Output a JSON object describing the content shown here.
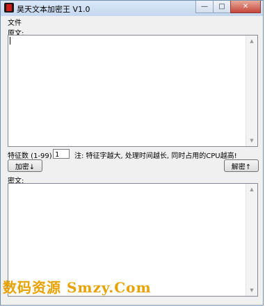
{
  "window": {
    "title": "昊天文本加密王 V1.0",
    "controls": {
      "minimize": "—",
      "maximize": "□",
      "close": "✕"
    }
  },
  "menu": {
    "file": "文件"
  },
  "plaintext": {
    "label": "原文:",
    "value": ""
  },
  "feature": {
    "label": "特征数 (1-99)",
    "value": "1",
    "note": "注: 特征字越大, 处理时间越长, 同时占用的CPU越高!"
  },
  "buttons": {
    "encrypt": "加密↓",
    "decrypt": "解密↑"
  },
  "ciphertext": {
    "label": "密文:",
    "value": ""
  },
  "watermark": "数码资源 Smzy.Com",
  "colors": {
    "title_bar": "#c4d7ef",
    "close_button": "#c4463a",
    "watermark": "#e8a200"
  },
  "icons": {
    "app": "app-icon",
    "scroll_up": "scroll-up-arrow-icon",
    "scroll_down": "scroll-down-arrow-icon"
  }
}
